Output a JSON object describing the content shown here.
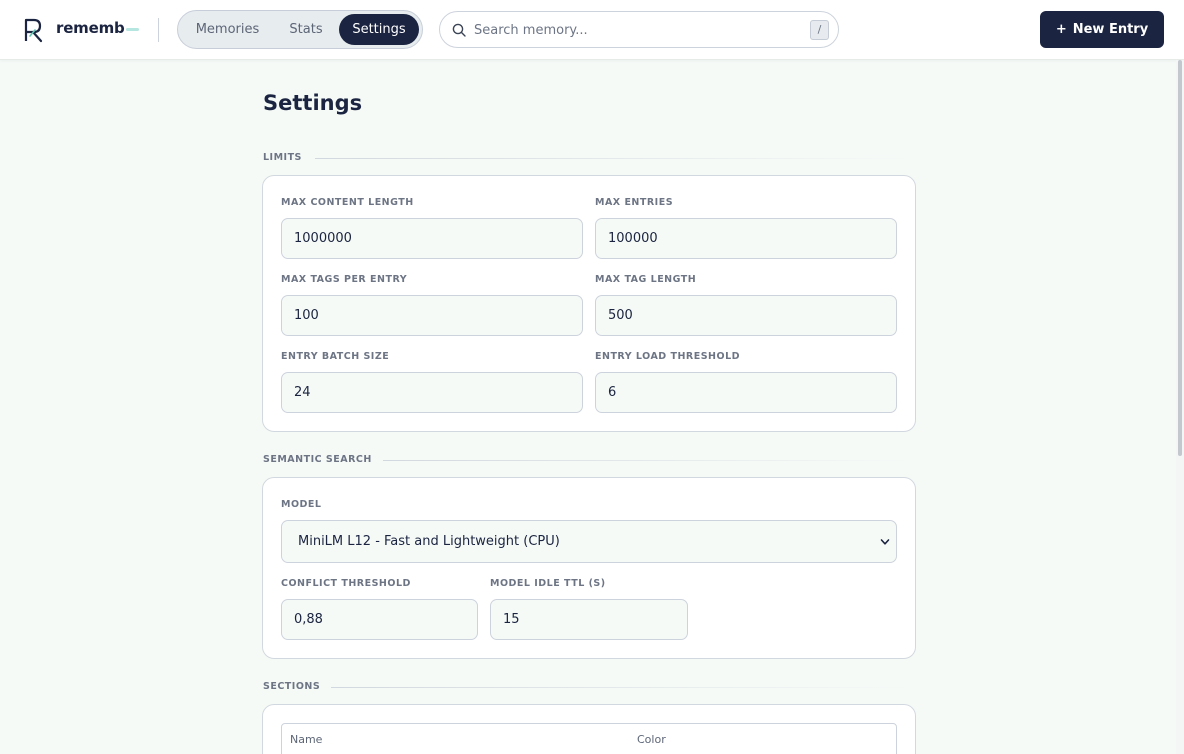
{
  "app": {
    "brand": "rememb"
  },
  "nav": {
    "tabs": [
      {
        "label": "Memories",
        "active": false
      },
      {
        "label": "Stats",
        "active": false
      },
      {
        "label": "Settings",
        "active": true
      }
    ]
  },
  "search": {
    "placeholder": "Search memory...",
    "shortcut": "/"
  },
  "header": {
    "new_entry_plus": "+",
    "new_entry_label": "New Entry"
  },
  "page": {
    "title": "Settings"
  },
  "limits": {
    "label": "LIMITS",
    "fields": [
      {
        "label": "MAX CONTENT LENGTH",
        "value": "1000000"
      },
      {
        "label": "MAX ENTRIES",
        "value": "100000"
      },
      {
        "label": "MAX TAGS PER ENTRY",
        "value": "100"
      },
      {
        "label": "MAX TAG LENGTH",
        "value": "500"
      },
      {
        "label": "ENTRY BATCH SIZE",
        "value": "24"
      },
      {
        "label": "ENTRY LOAD THRESHOLD",
        "value": "6"
      }
    ]
  },
  "semantic": {
    "label": "SEMANTIC SEARCH",
    "model_label": "MODEL",
    "model_value": "MiniLM L12 - Fast and Lightweight (CPU)",
    "conflict_label": "CONFLICT THRESHOLD",
    "conflict_value": "0,88",
    "ttl_label": "MODEL IDLE TTL (S)",
    "ttl_value": "15"
  },
  "sections": {
    "label": "SECTIONS",
    "columns": [
      "Name",
      "Color"
    ]
  },
  "colors": {
    "navy": "#1b2440",
    "page_bg": "#f6faf7",
    "accent_teal": "#b5e6df"
  }
}
